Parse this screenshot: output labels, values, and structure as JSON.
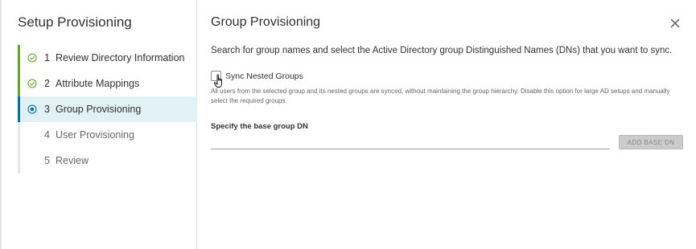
{
  "sidebar": {
    "title": "Setup Provisioning",
    "steps": [
      {
        "num": "1",
        "label": "Review Directory Information",
        "status": "done",
        "icon": "check-circle-icon"
      },
      {
        "num": "2",
        "label": "Attribute Mappings",
        "status": "done",
        "icon": "check-circle-icon"
      },
      {
        "num": "3",
        "label": "Group Provisioning",
        "status": "active",
        "icon": "dot-circle-icon"
      },
      {
        "num": "4",
        "label": "User Provisioning",
        "status": "pending"
      },
      {
        "num": "5",
        "label": "Review",
        "status": "pending"
      }
    ]
  },
  "main": {
    "title": "Group Provisioning",
    "description": "Search for group names and select the Active Directory group Distinguished Names (DNs) that you want to sync.",
    "sync_nested": {
      "label": "Sync Nested Groups",
      "checked": false,
      "help": "All users from the selected group and its nested groups are synced, without maintaining the group hierarchy. Disable this option for large AD setups and manually select the required groups."
    },
    "base_dn": {
      "label": "Specify the base group DN",
      "value": "",
      "button": "ADD BASE DN"
    }
  },
  "colors": {
    "done": "#62a420",
    "active": "#0072a3",
    "active_bg": "#e1f1f6"
  }
}
